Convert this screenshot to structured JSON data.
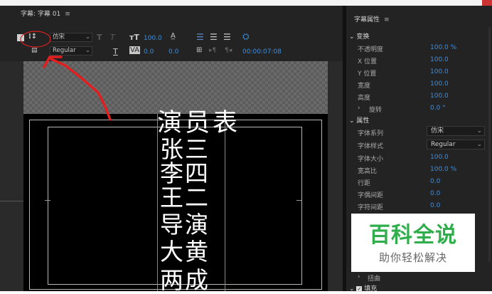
{
  "left_panel": {
    "title": "字幕: 字幕 01",
    "menu_glyph": "≡",
    "toolbar": {
      "font_family": "仿宋",
      "font_style": "Regular",
      "font_size": "100.0",
      "leading": "100.0",
      "kerning": "0.0",
      "tracking": "0.0",
      "timecode": "00:00:07:08"
    }
  },
  "subtitle": {
    "lines": [
      "演员表",
      "张三",
      "李四",
      "王二",
      "导演",
      "大黄",
      "两成"
    ]
  },
  "right_panel": {
    "title": "字幕属性",
    "menu_glyph": "≡",
    "transform": {
      "label": "变换",
      "rows": [
        {
          "label": "不透明度",
          "value": "100.0 %"
        },
        {
          "label": "X 位置",
          "value": "100.0"
        },
        {
          "label": "Y 位置",
          "value": "100.0"
        },
        {
          "label": "宽度",
          "value": "100.0"
        },
        {
          "label": "高度",
          "value": "100.0"
        },
        {
          "label": "旋转",
          "value": "0.0 °"
        }
      ]
    },
    "properties": {
      "label": "属性",
      "font_family": {
        "label": "字体系列",
        "value": "仿宋"
      },
      "font_style": {
        "label": "字体样式",
        "value": "Regular"
      },
      "rows": [
        {
          "label": "字体大小",
          "value": "100.0"
        },
        {
          "label": "宽高比",
          "value": "100.0 %"
        },
        {
          "label": "行距",
          "value": "0.0"
        },
        {
          "label": "字偶间距",
          "value": "0.0"
        },
        {
          "label": "字符间距",
          "value": "0.0"
        }
      ]
    },
    "distort": {
      "label": "扭曲"
    },
    "fill": {
      "label": "填充"
    }
  },
  "watermark": {
    "title": "百科全说",
    "subtitle": "助你轻松解决"
  },
  "colors": {
    "accent": "#3e8ede",
    "panel": "#232323",
    "annotation": "#e02020",
    "watermark_green": "#2fae4b"
  }
}
